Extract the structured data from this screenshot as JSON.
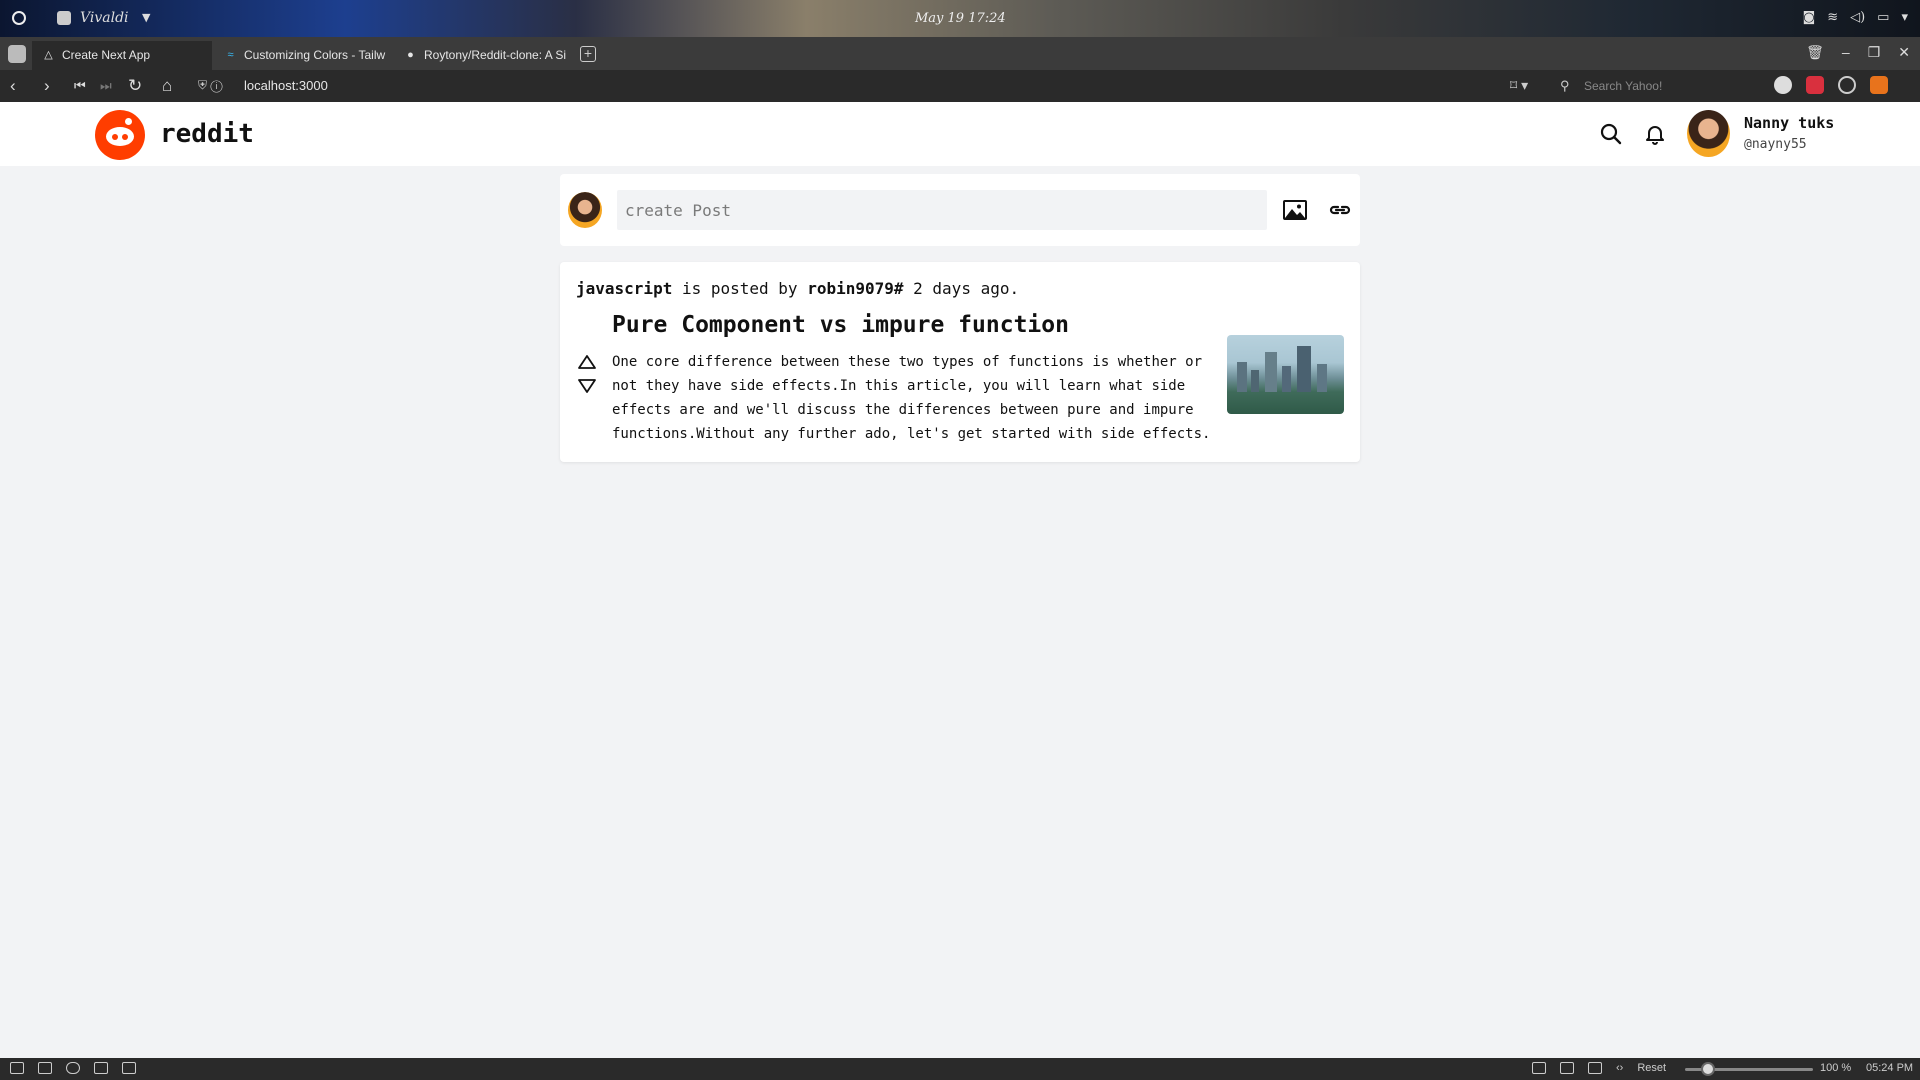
{
  "os": {
    "app_name": "Vivaldi",
    "clock": "May 19 17:24"
  },
  "browser": {
    "tabs": [
      {
        "label": "Create Next App",
        "active": true
      },
      {
        "label": "Customizing Colors - Tailw",
        "active": false
      },
      {
        "label": "Roytony/Reddit-clone: A Si",
        "active": false
      }
    ],
    "url": "localhost:3000",
    "search_placeholder": "Search Yahoo!"
  },
  "header": {
    "brand": "reddit",
    "user_name": "Nanny tuks",
    "user_handle": "@nayny55"
  },
  "create_post": {
    "placeholder": "create Post"
  },
  "post": {
    "community": "javascript",
    "posted_by_text": " is posted by ",
    "author": "robin9079#",
    "time_text": " 2 days ago.",
    "title": "Pure Component vs impure function",
    "body": "One core difference between these two types of functions is whether or not they have side effects.In this article, you will learn what side effects are and we'll discuss the differences between pure and impure functions.Without any further ado, let's get started with side effects."
  },
  "status_bar": {
    "reset_label": "Reset",
    "zoom": "100 %",
    "clock": "05:24 PM"
  },
  "colors": {
    "brand": "#ff3d00",
    "page_bg": "#f2f3f5",
    "browser_chrome": "#2a2a2a"
  }
}
